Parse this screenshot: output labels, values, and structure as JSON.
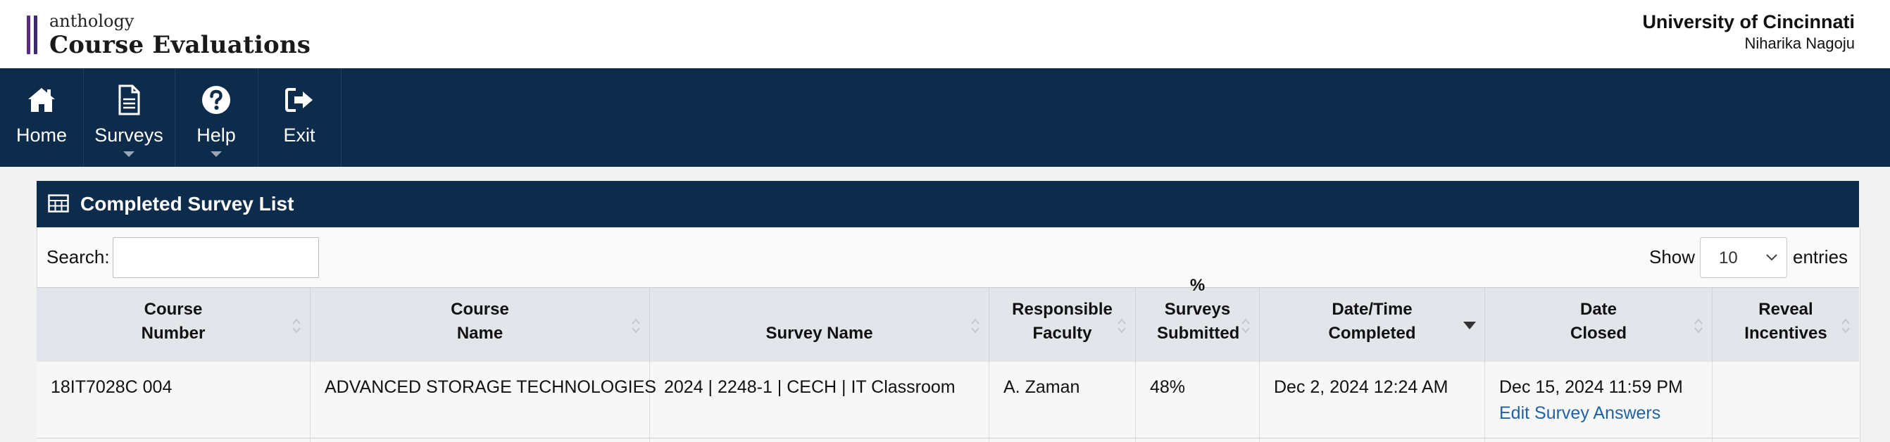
{
  "header": {
    "brand_small": "anthology",
    "brand_big": "Course Evaluations",
    "institution": "University of Cincinnati",
    "user": "Niharika Nagoju"
  },
  "nav": {
    "items": [
      {
        "label": "Home",
        "icon": "home-icon"
      },
      {
        "label": "Surveys",
        "icon": "document-icon",
        "has_dropdown": true
      },
      {
        "label": "Help",
        "icon": "question-circle-icon",
        "has_dropdown": true
      },
      {
        "label": "Exit",
        "icon": "sign-out-icon"
      }
    ]
  },
  "panel": {
    "title": "Completed Survey List",
    "icon": "table-icon",
    "search_label": "Search:",
    "search_value": "",
    "show_label": "Show",
    "entries_value": "10",
    "entries_label": "entries"
  },
  "table": {
    "columns": [
      {
        "line1": "Course",
        "line2": "Number"
      },
      {
        "line1": "Course",
        "line2": "Name"
      },
      {
        "line1": "",
        "line2": "Survey Name"
      },
      {
        "line1": "Responsible",
        "line2": "Faculty"
      },
      {
        "line1": "% Surveys",
        "line2": "Submitted"
      },
      {
        "line1": "Date/Time",
        "line2": "Completed"
      },
      {
        "line1": "Date",
        "line2": "Closed"
      },
      {
        "line1": "Reveal",
        "line2": "Incentives"
      }
    ],
    "sorted_column": "Date/Time Completed",
    "sort_direction": "descending",
    "rows": [
      {
        "course_number": "18IT7028C 004",
        "course_name": "ADVANCED STORAGE TECHNOLOGIES",
        "survey_name": "2024 | 2248-1 | CECH | IT Classroom",
        "faculty": "A. Zaman",
        "submitted": "48%",
        "completed": "Dec 2, 2024 12:24 AM",
        "closed": "Dec 15, 2024 11:59 PM",
        "action": "Edit Survey Answers",
        "incentives": ""
      }
    ]
  },
  "colors": {
    "navy": "#0d2b4b",
    "brand_purple": "#5b2b82",
    "link": "#1f62a6"
  }
}
